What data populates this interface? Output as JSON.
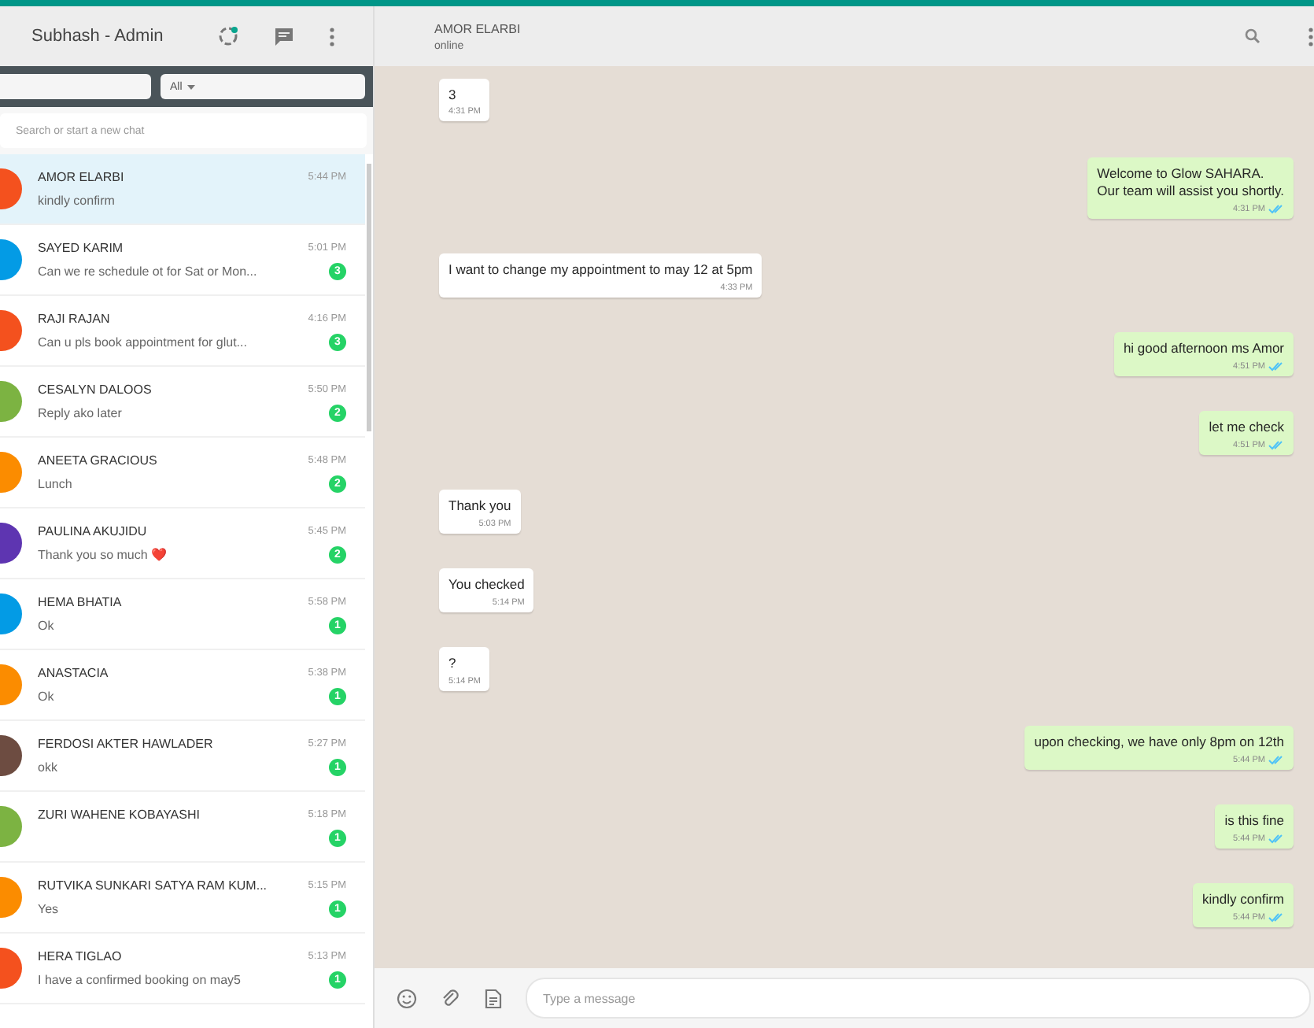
{
  "sidebar": {
    "title": "Subhash - Admin",
    "filter": {
      "value": "All"
    },
    "search": {
      "placeholder": "Search or start a new chat"
    },
    "chats": [
      {
        "name": "AMOR ELARBI",
        "preview": "kindly confirm",
        "time": "5:44 PM",
        "selected": true,
        "color": "#f4511e"
      },
      {
        "name": "SAYED KARIM",
        "preview": "Can we re schedule ot for Sat or Mon...",
        "time": "5:01 PM",
        "unread": "3",
        "selected": false,
        "color": "#039be5"
      },
      {
        "name": "RAJI RAJAN",
        "preview": "Can u pls book appointment for glut...",
        "time": "4:16 PM",
        "unread": "3",
        "selected": false,
        "color": "#f4511e"
      },
      {
        "name": "CESALYN DALOOS",
        "preview": "Reply ako later",
        "time": "5:50 PM",
        "unread": "2",
        "selected": false,
        "color": "#7cb342"
      },
      {
        "name": "ANEETA GRACIOUS",
        "preview": "Lunch",
        "time": "5:48 PM",
        "unread": "2",
        "selected": false,
        "color": "#fb8c00"
      },
      {
        "name": "PAULINA AKUJIDU",
        "preview": "Thank you so much ❤️",
        "time": "5:45 PM",
        "unread": "2",
        "selected": false,
        "color": "#5e35b1"
      },
      {
        "name": "HEMA BHATIA",
        "preview": "Ok",
        "time": "5:58 PM",
        "unread": "1",
        "selected": false,
        "color": "#039be5"
      },
      {
        "name": "ANASTACIA",
        "preview": "Ok",
        "time": "5:38 PM",
        "unread": "1",
        "selected": false,
        "color": "#fb8c00"
      },
      {
        "name": "FERDOSI AKTER HAWLADER",
        "preview": "okk",
        "time": "5:27 PM",
        "unread": "1",
        "selected": false,
        "color": "#6d4c41"
      },
      {
        "name": "ZURI WAHENE KOBAYASHI",
        "time": "5:18 PM",
        "unread": "1",
        "selected": false,
        "color": "#7cb342"
      },
      {
        "name": "RUTVIKA SUNKARI SATYA RAM KUM...",
        "preview": "Yes",
        "time": "5:15 PM",
        "unread": "1",
        "selected": false,
        "color": "#fb8c00"
      },
      {
        "name": "HERA TIGLAO",
        "preview": "I have a confirmed booking on may5",
        "time": "5:13 PM",
        "unread": "1",
        "selected": false,
        "color": "#f4511e"
      }
    ]
  },
  "chat": {
    "name": "AMOR ELARBI",
    "status": "online",
    "messages": [
      {
        "kind": "in",
        "lines": [
          "3"
        ],
        "time": "4:31 PM"
      },
      {
        "kind": "out",
        "lines": [
          "Welcome to Glow SAHARA.",
          "Our team will assist you shortly."
        ],
        "time": "4:31 PM"
      },
      {
        "kind": "in",
        "lines": [
          "I want to change my appointment to may 12 at 5pm"
        ],
        "time": "4:33 PM"
      },
      {
        "kind": "out",
        "lines": [
          "hi good afternoon ms Amor"
        ],
        "time": "4:51 PM"
      },
      {
        "kind": "out",
        "lines": [
          "let me check"
        ],
        "time": "4:51 PM"
      },
      {
        "kind": "in",
        "lines": [
          "Thank you"
        ],
        "time": "5:03 PM"
      },
      {
        "kind": "in",
        "lines": [
          "You checked"
        ],
        "time": "5:14 PM"
      },
      {
        "kind": "in",
        "lines": [
          "?"
        ],
        "time": "5:14 PM"
      },
      {
        "kind": "out",
        "lines": [
          "upon checking, we have only 8pm on 12th"
        ],
        "time": "5:44 PM"
      },
      {
        "kind": "out",
        "lines": [
          "is this fine"
        ],
        "time": "5:44 PM"
      },
      {
        "kind": "out",
        "lines": [
          "kindly confirm"
        ],
        "time": "5:44 PM"
      }
    ],
    "composer": {
      "placeholder": "Type a message"
    }
  }
}
